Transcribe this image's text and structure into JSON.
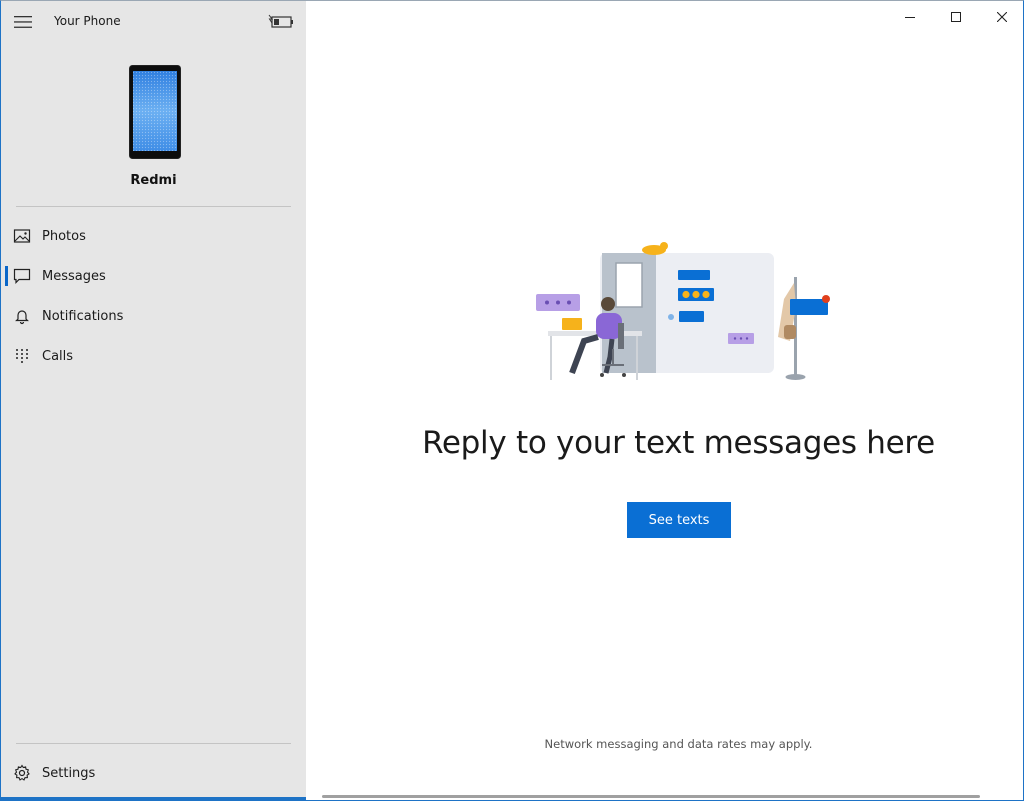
{
  "app": {
    "title": "Your Phone",
    "menu_icon": "hamburger-menu-icon",
    "battery_icon": "battery-charging-icon"
  },
  "device": {
    "name": "Redmi",
    "icon": "smartphone-image"
  },
  "sidebar": {
    "items": [
      {
        "label": "Photos",
        "icon": "photos-icon",
        "selected": false
      },
      {
        "label": "Messages",
        "icon": "message-icon",
        "selected": true
      },
      {
        "label": "Notifications",
        "icon": "bell-icon",
        "selected": false
      },
      {
        "label": "Calls",
        "icon": "dialpad-icon",
        "selected": false
      }
    ],
    "settings": {
      "label": "Settings",
      "icon": "gear-icon"
    }
  },
  "window_controls": {
    "minimize_icon": "minimize-icon",
    "maximize_icon": "maximize-icon",
    "close_icon": "close-icon"
  },
  "main": {
    "headline": "Reply to your text messages here",
    "primary_button": "See texts",
    "footnote": "Network messaging and data rates may apply."
  },
  "colors": {
    "accent": "#0a6fd4",
    "sidebar_bg": "#e6e6e6",
    "selection_bar": "#0a66c8"
  }
}
